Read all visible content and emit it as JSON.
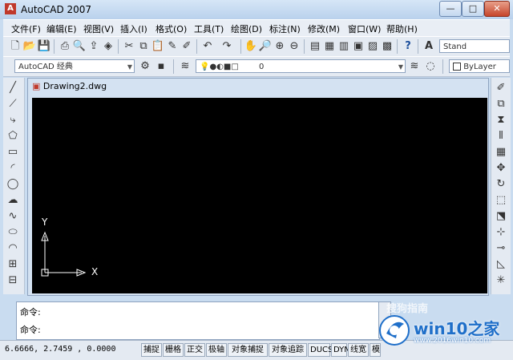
{
  "window": {
    "title": "AutoCAD 2007",
    "min": "—",
    "max": "□",
    "close": "✕"
  },
  "menubar": {
    "items": [
      "文件(F)",
      "编辑(E)",
      "视图(V)",
      "插入(I)",
      "格式(O)",
      "工具(T)",
      "绘图(D)",
      "标注(N)",
      "修改(M)",
      "窗口(W)",
      "帮助(H)"
    ]
  },
  "toolbar2": {
    "workspace": "AutoCAD 经典",
    "layer": "0",
    "bylayer": "ByLayer",
    "style_label": "Stand"
  },
  "document": {
    "tab_title": "Drawing2.dwg",
    "axis_x": "X",
    "axis_y": "Y"
  },
  "command": {
    "line1": "命令:",
    "line2": "命令:"
  },
  "status": {
    "coords": "6.6666, 2.7459 , 0.0000",
    "buttons": [
      "捕捉",
      "栅格",
      "正交",
      "极轴",
      "对象捕捉",
      "对象追踪",
      "DUCS",
      "DYN",
      "线宽",
      "模"
    ]
  },
  "watermark": {
    "brand": "win10之家",
    "url": "www.2016win10.com",
    "faded": "搜狗指南"
  },
  "colors": {
    "draw_bg": "#000000",
    "axis": "#ffffff",
    "accent": "#1f6fc9"
  }
}
